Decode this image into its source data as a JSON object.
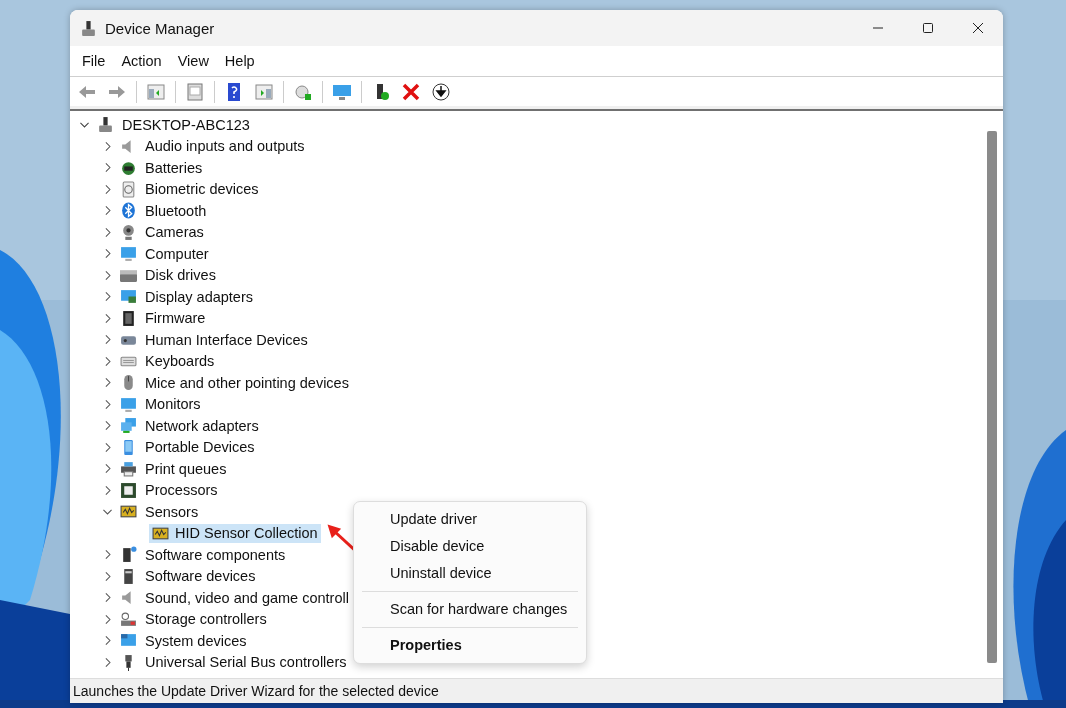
{
  "window": {
    "title": "Device Manager"
  },
  "menu": [
    "File",
    "Action",
    "View",
    "Help"
  ],
  "tree": {
    "label": "DESKTOP-ABC123",
    "expanded": true,
    "children": [
      {
        "label": "Audio inputs and outputs",
        "expanded": false,
        "selected": false
      },
      {
        "label": "Batteries",
        "expanded": false,
        "selected": false
      },
      {
        "label": "Biometric devices",
        "expanded": false,
        "selected": false
      },
      {
        "label": "Bluetooth",
        "expanded": false,
        "selected": false
      },
      {
        "label": "Cameras",
        "expanded": false,
        "selected": false
      },
      {
        "label": "Computer",
        "expanded": false,
        "selected": false
      },
      {
        "label": "Disk drives",
        "expanded": false,
        "selected": false
      },
      {
        "label": "Display adapters",
        "expanded": false,
        "selected": false
      },
      {
        "label": "Firmware",
        "expanded": false,
        "selected": false
      },
      {
        "label": "Human Interface Devices",
        "expanded": false,
        "selected": false
      },
      {
        "label": "Keyboards",
        "expanded": false,
        "selected": false
      },
      {
        "label": "Mice and other pointing devices",
        "expanded": false,
        "selected": false
      },
      {
        "label": "Monitors",
        "expanded": false,
        "selected": false
      },
      {
        "label": "Network adapters",
        "expanded": false,
        "selected": false
      },
      {
        "label": "Portable Devices",
        "expanded": false,
        "selected": false
      },
      {
        "label": "Print queues",
        "expanded": false,
        "selected": false
      },
      {
        "label": "Processors",
        "expanded": false,
        "selected": false
      },
      {
        "label": "Sensors",
        "expanded": true,
        "selected": false,
        "children": [
          {
            "label": "HID Sensor Collection",
            "selected": true
          }
        ]
      },
      {
        "label": "Software components",
        "expanded": false,
        "selected": false
      },
      {
        "label": "Software devices",
        "expanded": false,
        "selected": false
      },
      {
        "label": "Sound, video and game controll",
        "expanded": false,
        "selected": false
      },
      {
        "label": "Storage controllers",
        "expanded": false,
        "selected": false
      },
      {
        "label": "System devices",
        "expanded": false,
        "selected": false
      },
      {
        "label": "Universal Serial Bus controllers",
        "expanded": false,
        "selected": false
      }
    ]
  },
  "context_menu": {
    "groups": [
      [
        {
          "label": "Update driver",
          "default": false
        },
        {
          "label": "Disable device",
          "default": false
        },
        {
          "label": "Uninstall device",
          "default": false
        }
      ],
      [
        {
          "label": "Scan for hardware changes",
          "default": false
        }
      ],
      [
        {
          "label": "Properties",
          "default": true
        }
      ]
    ]
  },
  "status_bar": "Launches the Update Driver Wizard for the selected device"
}
